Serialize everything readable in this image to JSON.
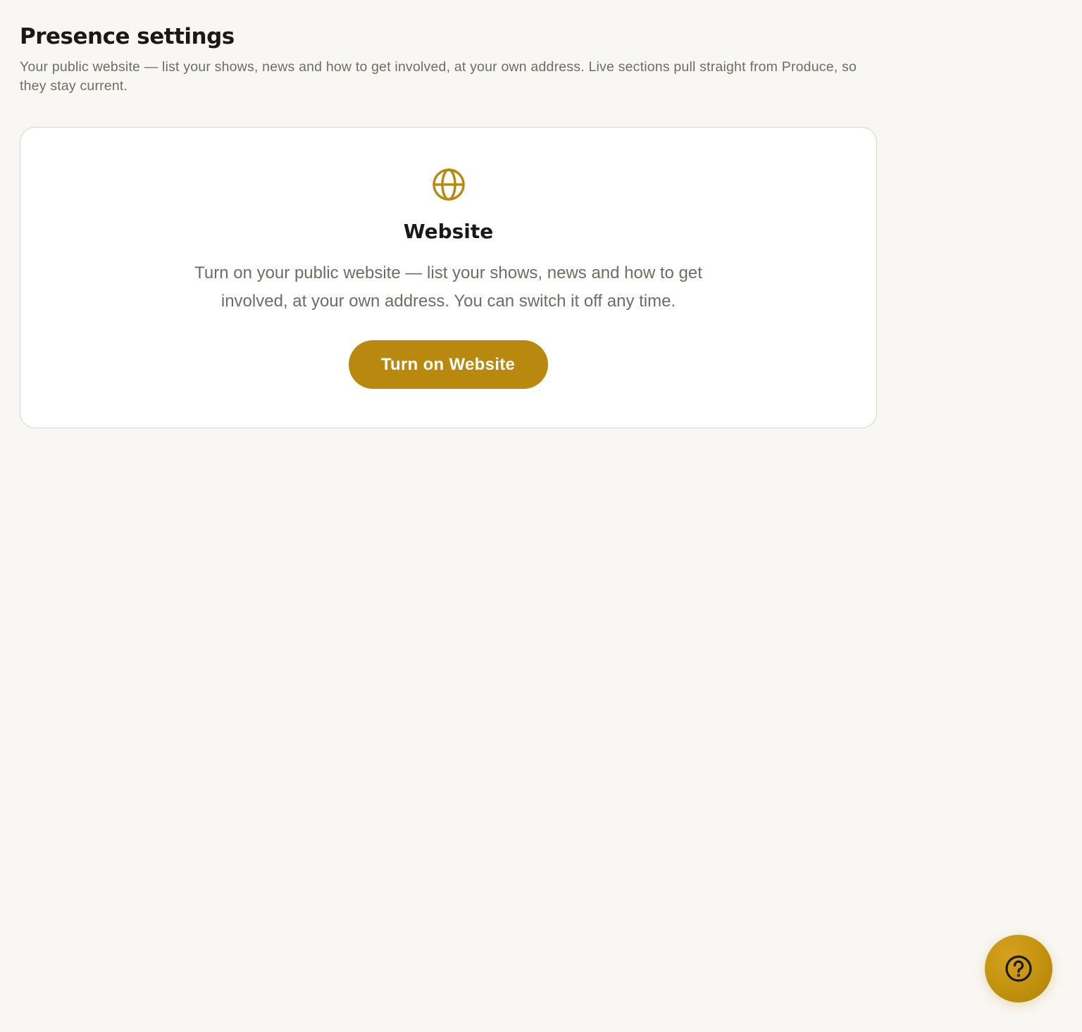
{
  "page": {
    "title": "Presence settings",
    "subtitle": "Your public website — list your shows, news and how to get involved, at your own address. Live sections pull straight from Produce, so they stay current."
  },
  "website_card": {
    "icon": "globe-icon",
    "title": "Website",
    "description": "Turn on your public website — list your shows, news and how to get involved, at your own address. You can switch it off any time.",
    "button_label": "Turn on Website"
  },
  "help_button": {
    "icon": "question-circle-icon"
  },
  "colors": {
    "accent": "#b8880f",
    "background": "#f9f7f3",
    "card_background": "#ffffff",
    "card_border": "#d9d3cb",
    "title_text": "#1b1916",
    "muted_text": "#726b63"
  }
}
